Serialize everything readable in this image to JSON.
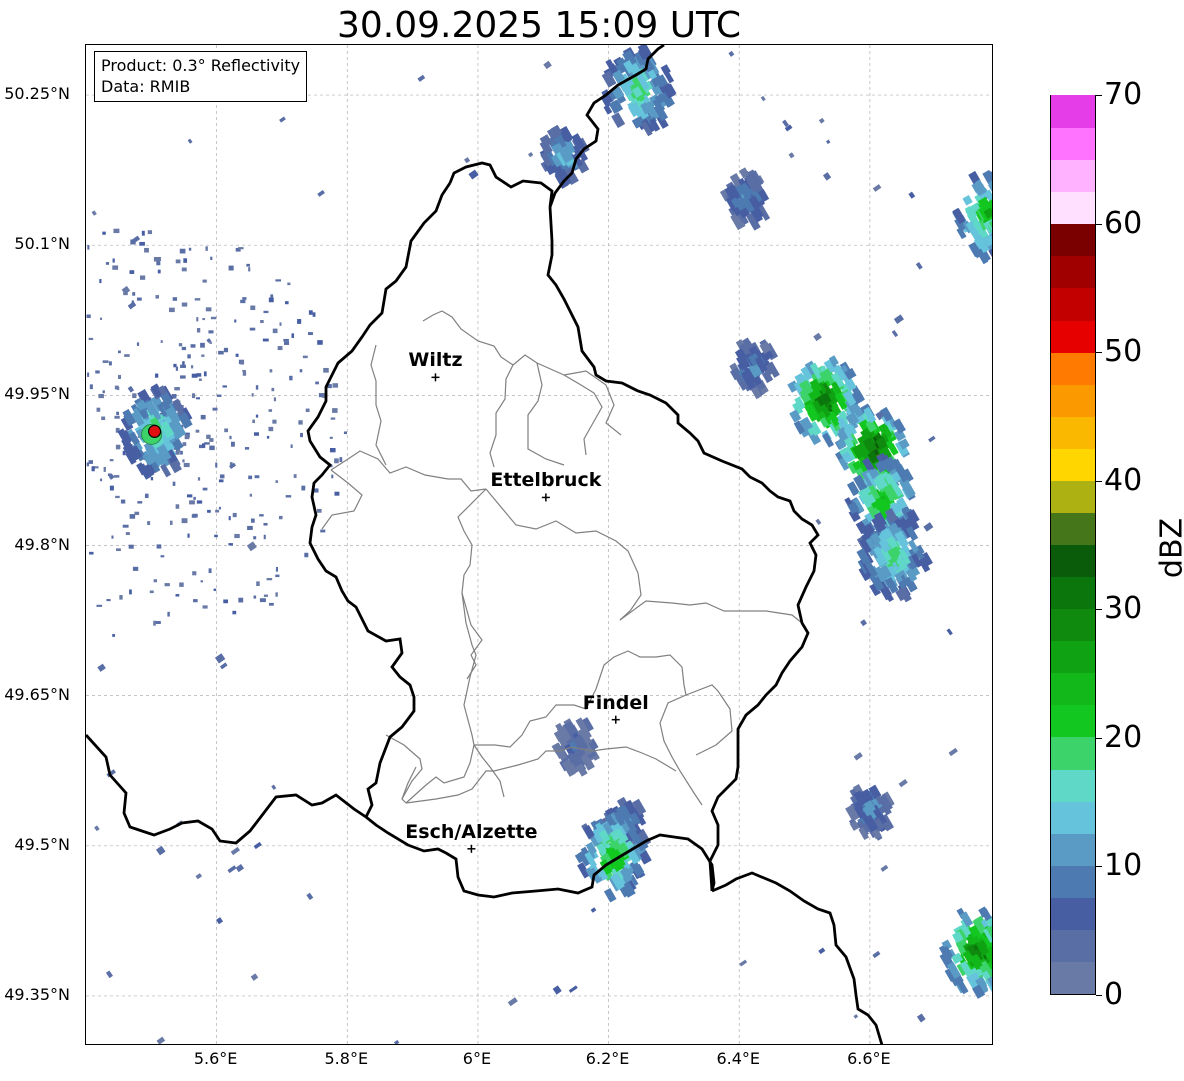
{
  "title": "30.09.2025 15:09 UTC",
  "info_box": {
    "product": "Product: 0.3° Reflectivity",
    "data": "Data: RMIB"
  },
  "axes": {
    "lat_ticks": [
      "50.25°N",
      "50.1°N",
      "49.95°N",
      "49.8°N",
      "49.65°N",
      "49.5°N",
      "49.35°N"
    ],
    "lon_ticks": [
      "5.6°E",
      "5.8°E",
      "6°E",
      "6.2°E",
      "6.4°E",
      "6.6°E"
    ],
    "lat_values": [
      50.25,
      50.1,
      49.95,
      49.8,
      49.65,
      49.5,
      49.35
    ],
    "lon_values": [
      5.6,
      5.8,
      6.0,
      6.2,
      6.4,
      6.6
    ],
    "lon_range": [
      5.4,
      6.79
    ],
    "lat_range": [
      49.3,
      50.3
    ],
    "grid": true
  },
  "cities": [
    {
      "name": "Wiltz",
      "lon": 5.935,
      "lat": 49.968
    },
    {
      "name": "Ettelbruck",
      "lon": 6.104,
      "lat": 49.848
    },
    {
      "name": "Findel",
      "lon": 6.211,
      "lat": 49.626
    },
    {
      "name": "Esch/Alzette",
      "lon": 5.99,
      "lat": 49.497
    }
  ],
  "radar_site": {
    "lon": 5.505,
    "lat": 49.914
  },
  "colorbar": {
    "label": "dBZ",
    "min": 0,
    "max": 70,
    "ticks": [
      "0",
      "10",
      "20",
      "30",
      "40",
      "50",
      "60",
      "70"
    ],
    "tick_values": [
      0,
      10,
      20,
      30,
      40,
      50,
      60,
      70
    ],
    "colors": [
      "#6a7aa6",
      "#5a6ea6",
      "#475ea3",
      "#4c7ab1",
      "#5a9bc6",
      "#66c3dc",
      "#60d8c8",
      "#3cd46a",
      "#12c820",
      "#12b81a",
      "#0fa212",
      "#0f8a0f",
      "#0b760c",
      "#0a5c0a",
      "#46761a",
      "#adb212",
      "#ffd600",
      "#fbb800",
      "#fb9a00",
      "#ff7a00",
      "#e60000",
      "#c20000",
      "#a00000",
      "#7a0000",
      "#ffe0ff",
      "#ffb2ff",
      "#ff73ff",
      "#e53ee9"
    ]
  },
  "echoes": [
    {
      "lon": 6.245,
      "lat": 50.255,
      "dbz": 20
    },
    {
      "lon": 6.13,
      "lat": 50.19,
      "dbz": 15
    },
    {
      "lon": 6.41,
      "lat": 50.145,
      "dbz": 12
    },
    {
      "lon": 6.42,
      "lat": 49.98,
      "dbz": 12
    },
    {
      "lon": 6.53,
      "lat": 49.945,
      "dbz": 32
    },
    {
      "lon": 6.605,
      "lat": 49.895,
      "dbz": 34
    },
    {
      "lon": 6.62,
      "lat": 49.845,
      "dbz": 24
    },
    {
      "lon": 6.635,
      "lat": 49.79,
      "dbz": 20
    },
    {
      "lon": 6.15,
      "lat": 49.6,
      "dbz": 8
    },
    {
      "lon": 6.225,
      "lat": 49.52,
      "dbz": 14
    },
    {
      "lon": 6.205,
      "lat": 49.49,
      "dbz": 24
    },
    {
      "lon": 6.6,
      "lat": 49.535,
      "dbz": 12
    },
    {
      "lon": 6.765,
      "lat": 49.395,
      "dbz": 30
    },
    {
      "lon": 6.78,
      "lat": 50.13,
      "dbz": 24
    },
    {
      "lon": 5.505,
      "lat": 49.914,
      "dbz": 20
    }
  ]
}
